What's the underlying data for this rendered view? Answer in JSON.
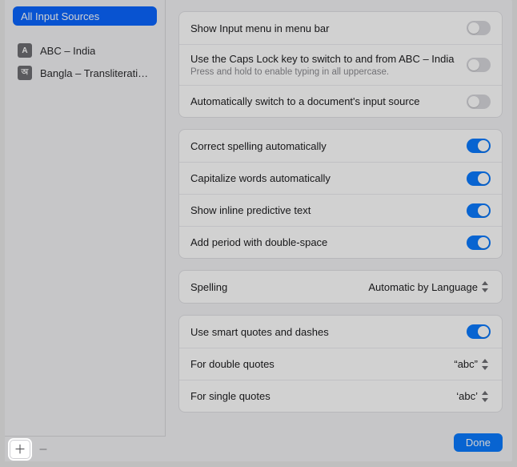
{
  "sidebar": {
    "all_label": "All Input Sources",
    "sources": [
      {
        "glyph": "A",
        "label": "ABC – India"
      },
      {
        "glyph": "অ",
        "label": "Bangla – Transliterati…"
      }
    ],
    "add_glyph": "＋",
    "remove_glyph": "–"
  },
  "group1": {
    "rows": [
      {
        "label": "Show Input menu in menu bar",
        "on": false
      },
      {
        "label": "Use the Caps Lock key to switch to and from ABC – India",
        "sub": "Press and hold to enable typing in all uppercase.",
        "on": false
      },
      {
        "label": "Automatically switch to a document's input source",
        "on": false
      }
    ]
  },
  "group2": {
    "rows": [
      {
        "label": "Correct spelling automatically",
        "on": true
      },
      {
        "label": "Capitalize words automatically",
        "on": true
      },
      {
        "label": "Show inline predictive text",
        "on": true
      },
      {
        "label": "Add period with double-space",
        "on": true
      }
    ]
  },
  "group3": {
    "label": "Spelling",
    "value": "Automatic by Language"
  },
  "group4": {
    "rows": [
      {
        "label": "Use smart quotes and dashes",
        "type": "toggle",
        "on": true
      },
      {
        "label": "For double quotes",
        "type": "value",
        "value": "“abc”"
      },
      {
        "label": "For single quotes",
        "type": "value",
        "value": "‘abc’"
      }
    ]
  },
  "done_label": "Done"
}
